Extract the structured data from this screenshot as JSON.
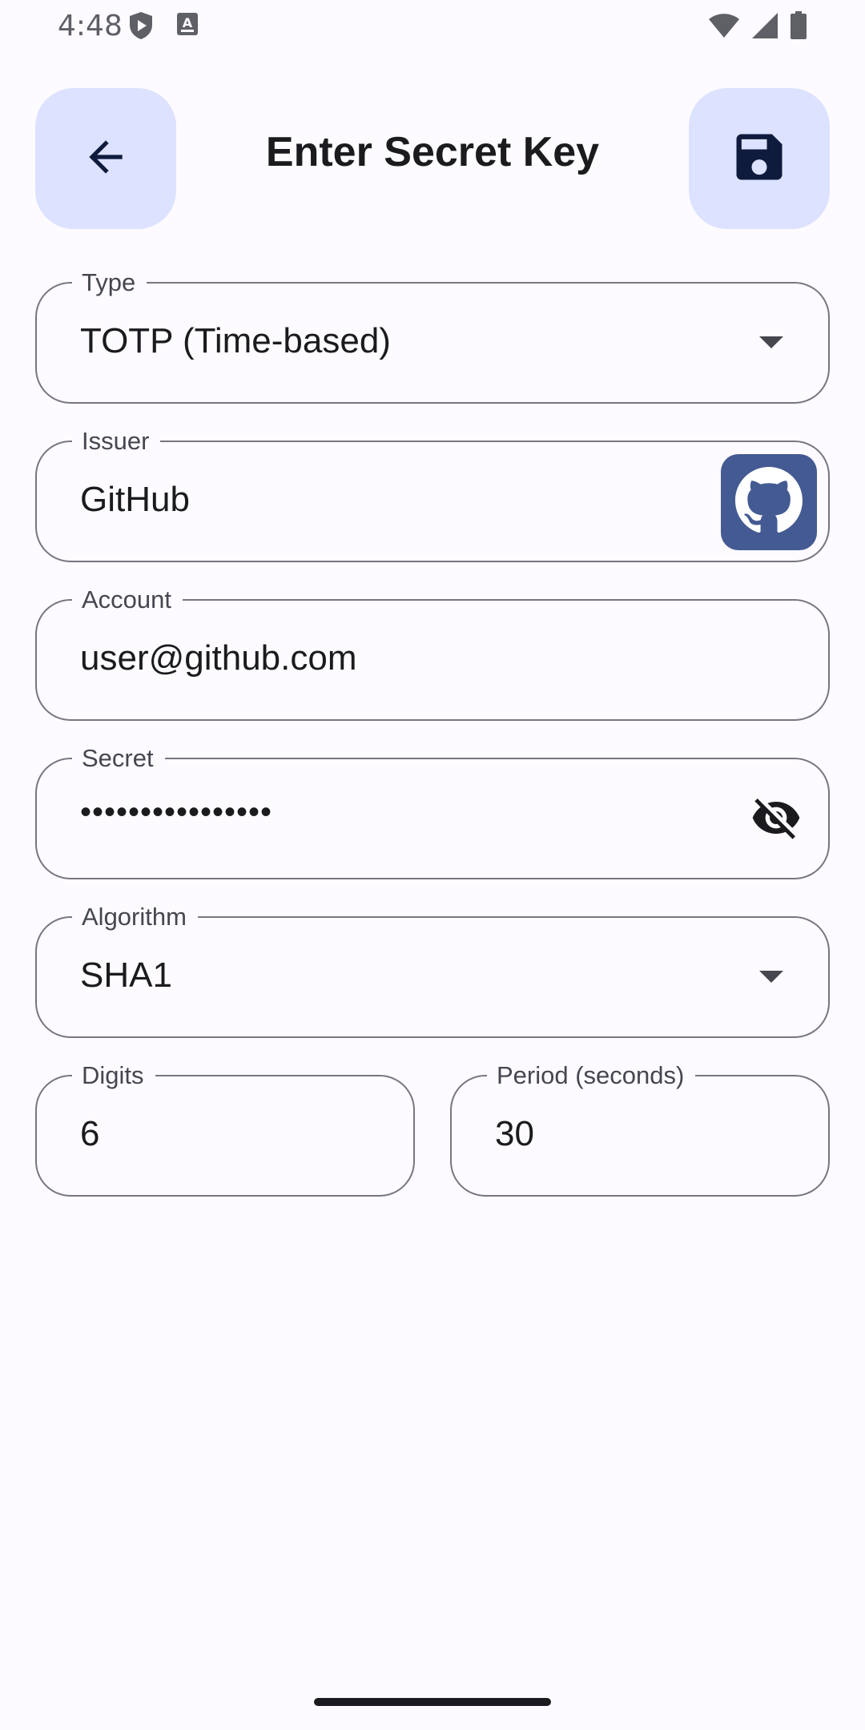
{
  "status_bar": {
    "time": "4:48",
    "icons": [
      "shield-play-icon",
      "keyboard-icon",
      "wifi-icon",
      "signal-icon",
      "battery-icon"
    ]
  },
  "header": {
    "title": "Enter Secret Key",
    "back_icon": "arrow-back-icon",
    "save_icon": "save-icon"
  },
  "form": {
    "type": {
      "label": "Type",
      "value": "TOTP (Time-based)"
    },
    "issuer": {
      "label": "Issuer",
      "value": "GitHub",
      "icon": "github-icon"
    },
    "account": {
      "label": "Account",
      "value": "user@github.com"
    },
    "secret": {
      "label": "Secret",
      "value": "••••••••••••••••",
      "toggle_icon": "visibility-off-icon"
    },
    "algorithm": {
      "label": "Algorithm",
      "value": "SHA1"
    },
    "digits": {
      "label": "Digits",
      "value": "6"
    },
    "period": {
      "label": "Period (seconds)",
      "value": "30"
    }
  },
  "colors": {
    "background": "#fdfbff",
    "button_container": "#dce2ff",
    "on_button": "#0f1b3d",
    "outline": "#777680",
    "issuer_badge": "#445a92"
  }
}
